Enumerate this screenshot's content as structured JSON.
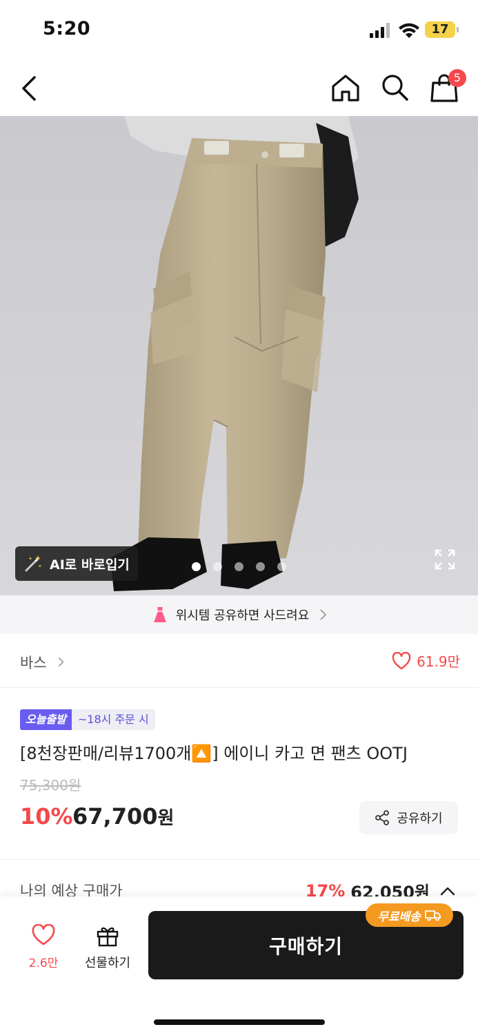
{
  "status_bar": {
    "time": "5:20",
    "battery": "17"
  },
  "nav": {
    "cart_count": "5"
  },
  "hero": {
    "ai_button_label": "AI로 바로입기",
    "image_count": 5,
    "active_image_index": 0
  },
  "wish_banner": {
    "text": "위시템 공유하면 사드려요"
  },
  "brand": {
    "name": "바스",
    "likes": "61.9만"
  },
  "product": {
    "tag_delivery": "오늘출발",
    "tag_condition": "~18시 주문 시",
    "title": "[8천장판매/리뷰1700개🔼] 에이니 카고 면 팬츠 OOTJ",
    "original_price": "75,300원",
    "discount": "10%",
    "price": "67,700",
    "price_unit": "원",
    "share_label": "공유하기"
  },
  "expected_price": {
    "label": "나의 예상 구매가",
    "discount": "17%",
    "price": "62,050원"
  },
  "bottom_bar": {
    "wish_count": "2.6만",
    "gift_label": "선물하기",
    "buy_label": "구매하기",
    "free_shipping": "무료배송"
  },
  "colors": {
    "accent_red": "#f5484b",
    "badge_purple": "#6a5cf0",
    "free_ship_orange": "#f59a21",
    "buy_button": "#1a1a1a"
  }
}
